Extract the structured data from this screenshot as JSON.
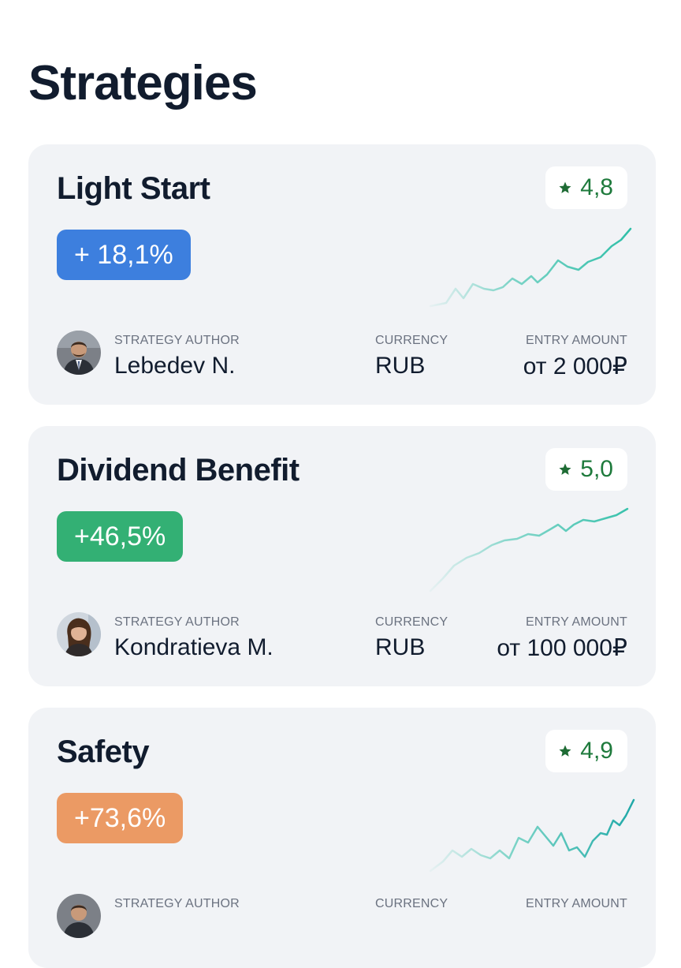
{
  "page": {
    "title": "Strategies"
  },
  "labels": {
    "author": "STRATEGY AUTHOR",
    "currency": "CURRENCY",
    "entry": "ENTRY AMOUNT"
  },
  "strategies": [
    {
      "name": "Light Start",
      "rating": "4,8",
      "return": "+ 18,1%",
      "return_color": "#3d7fde",
      "author": "Lebedev N.",
      "currency": "RUB",
      "entry_amount": "от 2 000₽",
      "avatar": "male-author-avatar"
    },
    {
      "name": "Dividend Benefit",
      "rating": "5,0",
      "return": "+46,5%",
      "return_color": "#33b074",
      "author": "Kondratieva M.",
      "currency": "RUB",
      "entry_amount": "от 100 000₽",
      "avatar": "female-author-avatar"
    },
    {
      "name": "Safety",
      "rating": "4,9",
      "return": "+73,6%",
      "return_color": "#eb9a64",
      "author": "",
      "currency": "",
      "entry_amount": "",
      "avatar": "male-author-avatar"
    }
  ],
  "colors": {
    "rating_green": "#1e7a3c",
    "sparkline": "#2fbfa8",
    "card_bg": "#f1f3f6"
  }
}
